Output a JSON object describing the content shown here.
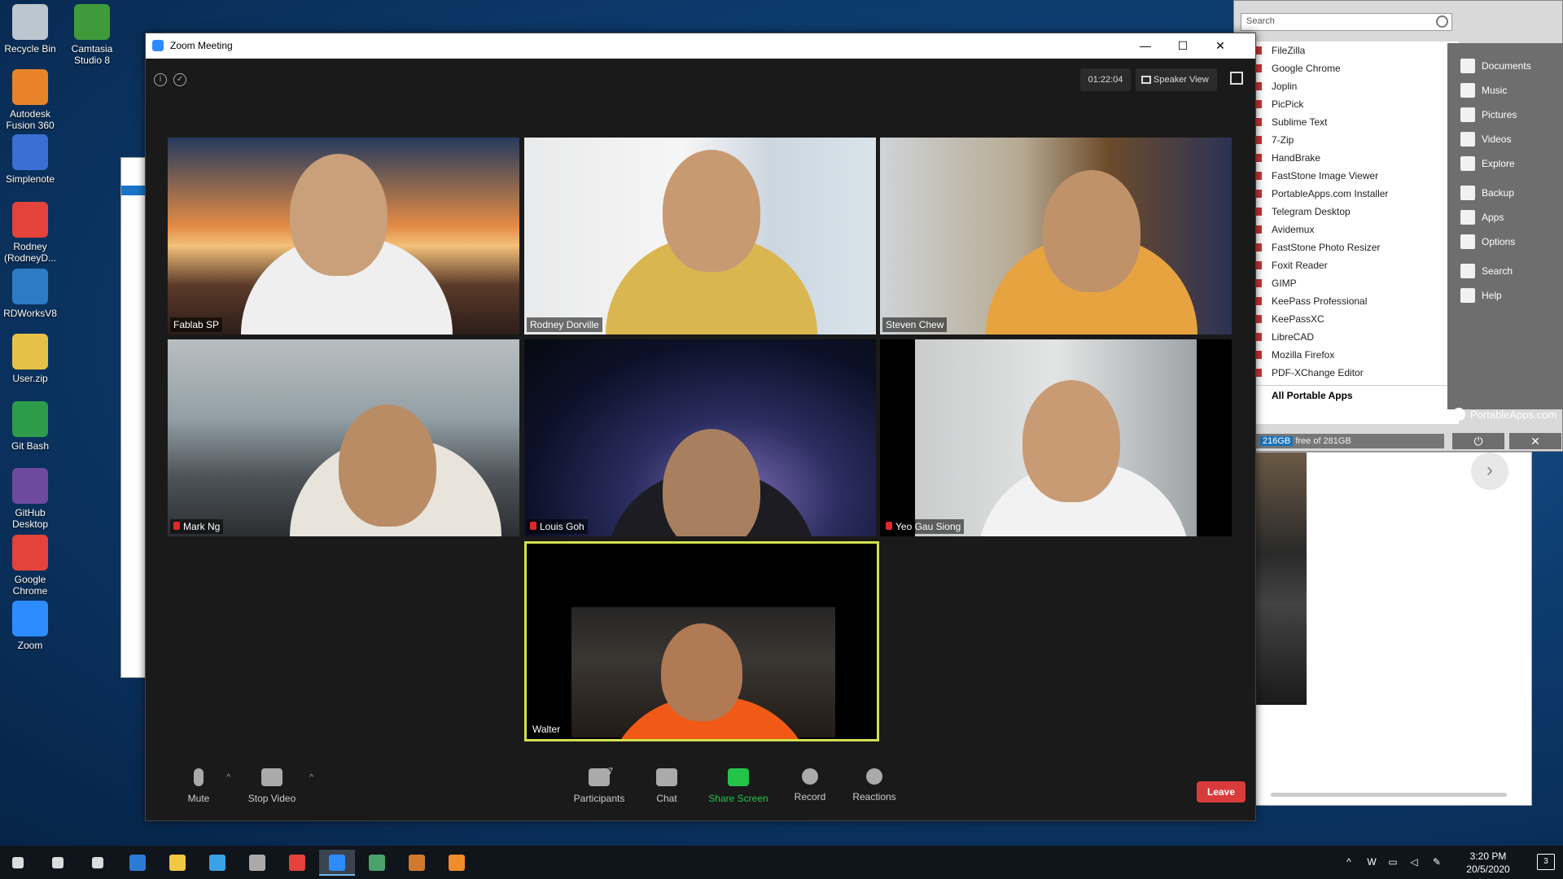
{
  "desktop": {
    "icons": [
      {
        "label": "Recycle Bin",
        "icon": "recycle-bin-icon",
        "color": "#bcc6cf"
      },
      {
        "label": "Camtasia Studio 8",
        "icon": "camtasia-icon",
        "color": "#3f9b3a"
      },
      {
        "label": "Autodesk Fusion 360",
        "icon": "fusion360-icon",
        "color": "#e8832a"
      },
      {
        "label": "Simplenote",
        "icon": "simplenote-icon",
        "color": "#3b6fd1"
      },
      {
        "label": "Rodney (RodneyD...",
        "icon": "chrome-icon",
        "color": "#e3433a"
      },
      {
        "label": "RDWorksV8",
        "icon": "rdworks-icon",
        "color": "#2e7bc5"
      },
      {
        "label": "User.zip",
        "icon": "zip-folder-icon",
        "color": "#e5c247"
      },
      {
        "label": "Git Bash",
        "icon": "git-bash-icon",
        "color": "#2c9c4a"
      },
      {
        "label": "GitHub Desktop",
        "icon": "github-desktop-icon",
        "color": "#6e4a9e"
      },
      {
        "label": "Google Chrome",
        "icon": "chrome-icon",
        "color": "#e3433a"
      },
      {
        "label": "Zoom",
        "icon": "zoom-icon",
        "color": "#2d8cff"
      }
    ]
  },
  "portableapps": {
    "search_placeholder": "Search",
    "apps": [
      "FileZilla",
      "Google Chrome",
      "Joplin",
      "PicPick",
      "Sublime Text",
      "7-Zip",
      "HandBrake",
      "FastStone Image Viewer",
      "PortableApps.com Installer",
      "Telegram Desktop",
      "Avidemux",
      "FastStone Photo Resizer",
      "Foxit Reader",
      "GIMP",
      "KeePass Professional",
      "KeePassXC",
      "LibreCAD",
      "Mozilla Firefox",
      "PDF-XChange Editor"
    ],
    "all_apps": "All Portable Apps",
    "side_items": [
      "Documents",
      "Music",
      "Pictures",
      "Videos",
      "Explore",
      "Backup",
      "Apps",
      "Options",
      "Search",
      "Help"
    ],
    "brand": "PortableApps.com",
    "free_used": "216GB",
    "free_rest": "free of 281GB",
    "power_icon": "⏻",
    "close_icon": "✕"
  },
  "zoom": {
    "title": "Zoom Meeting",
    "timer": "01:22:04",
    "view_label": "Speaker View",
    "participants": [
      {
        "name": "Fablab SP",
        "muted": false
      },
      {
        "name": "Rodney Dorville",
        "muted": false
      },
      {
        "name": "Steven Chew",
        "muted": false
      },
      {
        "name": "Mark Ng",
        "muted": true
      },
      {
        "name": "Louis Goh",
        "muted": true
      },
      {
        "name": "Yeo Gau Siong",
        "muted": true
      },
      {
        "name": "Walter",
        "muted": false
      }
    ],
    "toolbar": {
      "mute": "Mute",
      "stop_video": "Stop Video",
      "participants": "Participants",
      "participants_count": "7",
      "chat": "Chat",
      "share_screen": "Share Screen",
      "record": "Record",
      "reactions": "Reactions",
      "leave": "Leave"
    },
    "accent_color": "#24c44b",
    "active_speaker_color": "#d2e04d",
    "leave_color": "#d93b3b"
  },
  "taskbar": {
    "time": "3:20 PM",
    "date": "20/5/2020",
    "notification_count": "3",
    "apps": [
      "start-icon",
      "search-icon",
      "task-view-icon",
      "edge-icon",
      "file-explorer-icon",
      "ie-icon",
      "browser-icon",
      "chrome-icon",
      "zoom-icon",
      "globe-icon",
      "app-icon",
      "sublime-icon"
    ]
  }
}
